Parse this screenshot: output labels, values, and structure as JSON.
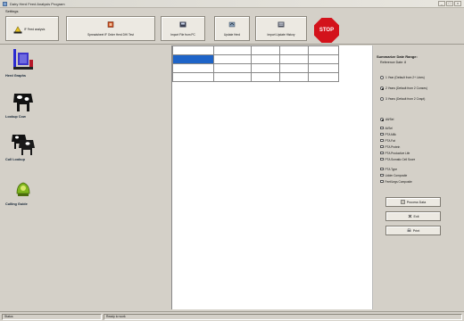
{
  "window": {
    "title": "Dairy Herd Feed Analysis Program",
    "controls": {
      "minimize": "_",
      "maximize": "□",
      "close": "×"
    }
  },
  "menubar": {
    "items": [
      "Settings"
    ]
  },
  "toolbar": {
    "buttons": [
      {
        "label": "IF Feed analysis",
        "icon": "feed-icon"
      },
      {
        "label": "Spreadsheet IF Order Herd DHI Test",
        "icon": "spreadsheet-icon"
      },
      {
        "label": "Import File from PC",
        "icon": "import-icon"
      },
      {
        "label": "Update Herd",
        "icon": "update-icon"
      },
      {
        "label": "Import Update History",
        "icon": "history-icon"
      }
    ],
    "stop_label": "STOP"
  },
  "sidebar": {
    "items": [
      {
        "label": "Herd Graphs",
        "icon": "herd-graphs-icon"
      },
      {
        "label": "Lookup Cow",
        "icon": "cow-icon"
      },
      {
        "label": "Cull Lookup",
        "icon": "cull-cows-icon"
      },
      {
        "label": "Culling Guide",
        "icon": "culling-guide-icon"
      }
    ]
  },
  "right_panel": {
    "title": "Summarize Date Range:",
    "subtitle": "Reference Date: 8",
    "range_options": [
      {
        "label": "1 Year (Default from 2+ Lines)",
        "selected": false
      },
      {
        "label": "2 Years (Default from 2 Conses)",
        "selected": true
      },
      {
        "label": "3 Years (Default from 2 Cnspt)",
        "selected": false
      }
    ],
    "field_options": [
      {
        "label": "All/Sel",
        "type": "radio",
        "checked": true
      },
      {
        "label": "Al/Sel",
        "type": "check",
        "checked": false
      },
      {
        "label": "PTA Milk",
        "type": "check",
        "checked": false
      },
      {
        "label": "PTA Fat",
        "type": "check",
        "checked": false
      },
      {
        "label": "PTA Protein",
        "type": "check",
        "checked": false
      },
      {
        "label": "PTA Productive Life",
        "type": "check",
        "checked": false
      },
      {
        "label": "PTA Somatic Cell Score",
        "type": "check",
        "checked": false
      },
      {
        "label": "PTA Type",
        "type": "check",
        "checked": false
      },
      {
        "label": "Udder Composite",
        "type": "check",
        "checked": false
      },
      {
        "label": "Feet/Legs Composite",
        "type": "check",
        "checked": false
      }
    ],
    "buttons": [
      {
        "label": "Process Data",
        "icon": "process-icon"
      },
      {
        "label": "Exit",
        "icon": "exit-icon"
      },
      {
        "label": "Print",
        "icon": "print-icon"
      }
    ]
  },
  "grid": {
    "columns": 5,
    "rows": 4,
    "selected_cell": [
      1,
      0
    ]
  },
  "statusbar": {
    "panes": [
      "Status",
      "Ready to work"
    ]
  },
  "colors": {
    "accent": "#1e64c8",
    "stop": "#d3121b",
    "chrome": "#d4d0c8"
  }
}
